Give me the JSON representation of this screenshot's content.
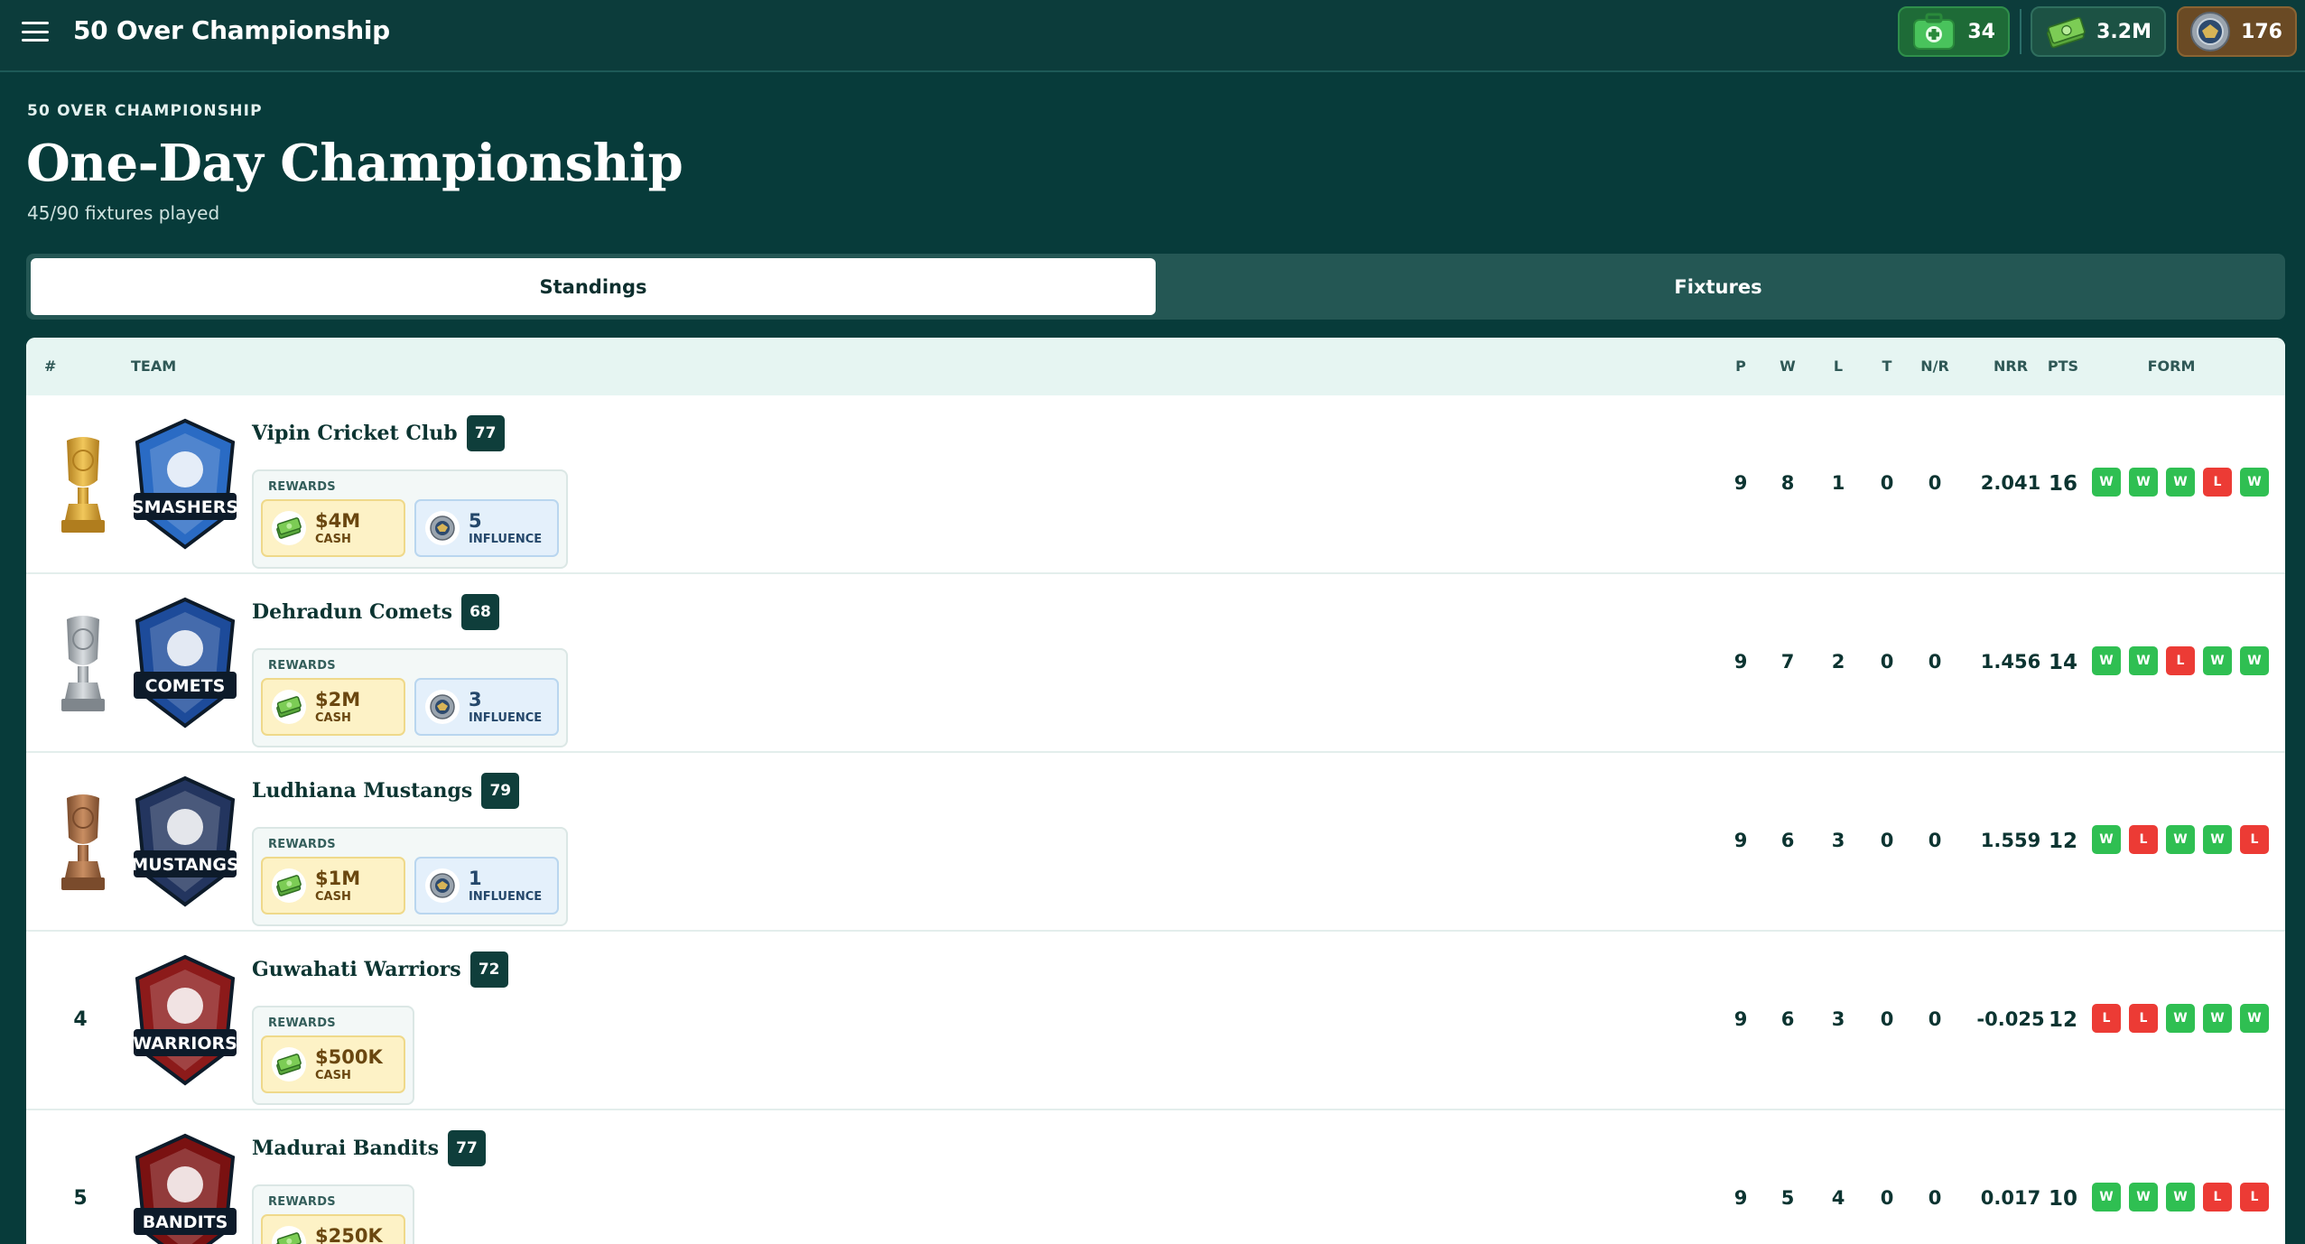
{
  "topbar": {
    "title": "50 Over Championship",
    "currencies": {
      "health": "34",
      "cash": "3.2M",
      "influence": "176"
    }
  },
  "header": {
    "eyebrow": "50 OVER CHAMPIONSHIP",
    "title": "One-Day Championship",
    "subtitle": "45/90 fixtures played"
  },
  "tabs": [
    {
      "label": "Standings",
      "active": true
    },
    {
      "label": "Fixtures",
      "active": false
    }
  ],
  "table": {
    "columns": {
      "rank": "#",
      "team": "TEAM",
      "p": "P",
      "w": "W",
      "l": "L",
      "t": "T",
      "nr": "N/R",
      "nrr": "NRR",
      "pts": "PTS",
      "form": "FORM"
    },
    "rewards_label": "REWARDS",
    "cash_label": "CASH",
    "influence_label": "INFLUENCE",
    "rows": [
      {
        "rank": "1",
        "medal": "gold",
        "team": "Vipin Cricket Club",
        "ovr": "77",
        "logo": "SMASHERS",
        "logo_color": "#2a6bc4",
        "cash": "$4M",
        "influence": "5",
        "p": "9",
        "w": "8",
        "l": "1",
        "t": "0",
        "nr": "0",
        "nrr": "2.041",
        "pts": "16",
        "form": [
          "W",
          "W",
          "W",
          "L",
          "W"
        ]
      },
      {
        "rank": "2",
        "medal": "silver",
        "team": "Dehradun Comets",
        "ovr": "68",
        "logo": "COMETS",
        "logo_color": "#1d4b9a",
        "cash": "$2M",
        "influence": "3",
        "p": "9",
        "w": "7",
        "l": "2",
        "t": "0",
        "nr": "0",
        "nrr": "1.456",
        "pts": "14",
        "form": [
          "W",
          "W",
          "L",
          "W",
          "W"
        ]
      },
      {
        "rank": "3",
        "medal": "bronze",
        "team": "Ludhiana Mustangs",
        "ovr": "79",
        "logo": "MUSTANGS",
        "logo_color": "#23355f",
        "cash": "$1M",
        "influence": "1",
        "p": "9",
        "w": "6",
        "l": "3",
        "t": "0",
        "nr": "0",
        "nrr": "1.559",
        "pts": "12",
        "form": [
          "W",
          "L",
          "W",
          "W",
          "L"
        ]
      },
      {
        "rank": "4",
        "medal": "",
        "team": "Guwahati Warriors",
        "ovr": "72",
        "logo": "WARRIORS",
        "logo_color": "#8c1a1a",
        "cash": "$500K",
        "influence": "",
        "p": "9",
        "w": "6",
        "l": "3",
        "t": "0",
        "nr": "0",
        "nrr": "-0.025",
        "pts": "12",
        "form": [
          "L",
          "L",
          "W",
          "W",
          "W"
        ]
      },
      {
        "rank": "5",
        "medal": "",
        "team": "Madurai Bandits",
        "ovr": "77",
        "logo": "BANDITS",
        "logo_color": "#7a1111",
        "cash": "$250K",
        "influence": "",
        "p": "9",
        "w": "5",
        "l": "4",
        "t": "0",
        "nr": "0",
        "nrr": "0.017",
        "pts": "10",
        "form": [
          "W",
          "W",
          "W",
          "L",
          "L"
        ]
      }
    ]
  },
  "colors": {
    "background": "#073b3a",
    "win": "#2fbf52",
    "loss": "#ec3b35",
    "gold": "#d4a23a",
    "silver": "#b8bcbf",
    "bronze": "#a8704a"
  },
  "icons": {
    "menu": "hamburger-icon",
    "health": "medkit-icon",
    "cash": "cash-stack-icon",
    "influence": "influence-medal-icon"
  }
}
